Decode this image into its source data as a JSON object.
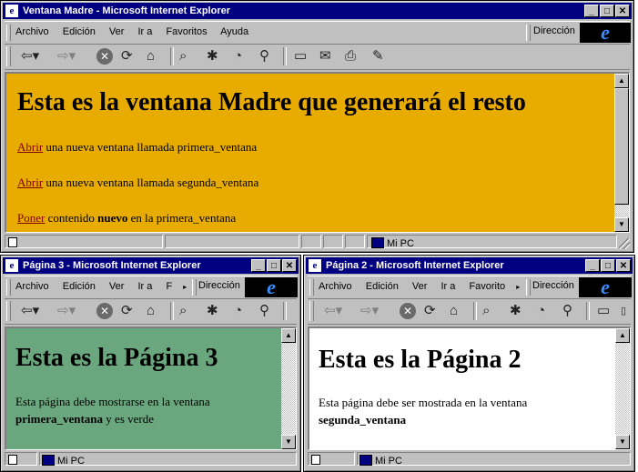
{
  "colors": {
    "titlebar": "#000080",
    "madre_bg": "#e8ac00",
    "page3_bg": "#6aa77f",
    "page2_bg": "#ffffff",
    "link": "#800000"
  },
  "madre": {
    "title": "Ventana Madre - Microsoft Internet Explorer",
    "menu": [
      "Archivo",
      "Edición",
      "Ver",
      "Ir a",
      "Favoritos",
      "Ayuda"
    ],
    "address_label": "Dirección",
    "heading": "Esta es la ventana Madre que generará el resto",
    "lines": [
      {
        "link": "Abrir",
        "text": " una nueva ventana llamada primera_ventana"
      },
      {
        "link": "Abrir",
        "text": " una nueva ventana llamada segunda_ventana"
      },
      {
        "link": "Poner",
        "text_before": " contenido ",
        "bold": "nuevo",
        "text_after": " en la primera_ventana"
      }
    ],
    "zone": "Mi PC"
  },
  "page3": {
    "title": "Página 3 - Microsoft Internet Explorer",
    "menu": [
      "Archivo",
      "Edición",
      "Ver",
      "Ir a",
      "F"
    ],
    "address_label": "Dirección",
    "heading": "Esta es la Página 3",
    "para_line1": "Esta página debe mostrarse en la ventana",
    "para_bold": "primera_ventana",
    "para_after": " y es verde",
    "zone": "Mi PC"
  },
  "page2": {
    "title": "Página 2 - Microsoft Internet Explorer",
    "menu": [
      "Archivo",
      "Edición",
      "Ver",
      "Ir a",
      "Favorito"
    ],
    "address_label": "Dirección",
    "heading": "Esta es la Página 2",
    "para_line1": "Esta página debe ser mostrada en la ventana",
    "para_bold": "segunda_ventana",
    "zone": "Mi PC"
  }
}
